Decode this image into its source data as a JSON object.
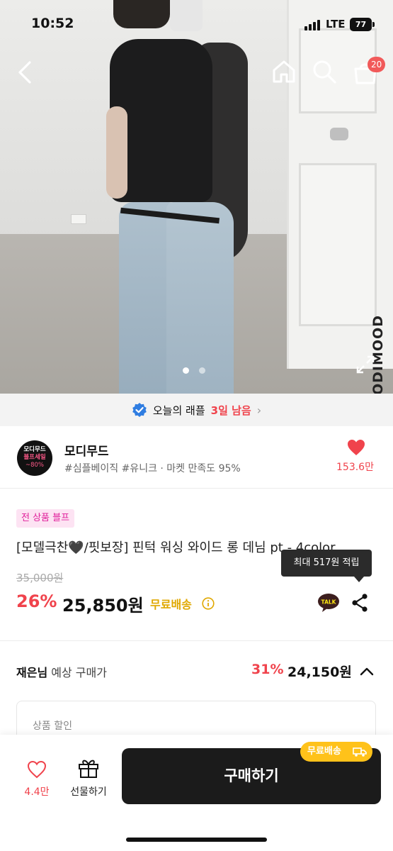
{
  "status_bar": {
    "time": "10:52",
    "network": "LTE",
    "battery": "77"
  },
  "nav": {
    "cart_count": "20"
  },
  "hero": {
    "watermark": "ODIMOOD",
    "dots": 2,
    "active_dot": 1
  },
  "raffle": {
    "label": "오늘의 래플",
    "remaining": "3일 남음"
  },
  "shop": {
    "logo_line1": "모디무드",
    "logo_line2": "블프세일",
    "logo_line3": "~80%",
    "name": "모디무드",
    "tags": "#심플베이직 #유니크 · 마켓 만족도 95%",
    "likes": "153.6만"
  },
  "product": {
    "badge": "전 상품 블프",
    "title": "[모델극찬🖤/핏보장] 핀턱 워싱 와이드 롱 데님 pt - 4color",
    "original_price": "35,000원",
    "discount_rate": "26%",
    "price": "25,850원",
    "shipping": "무료배송",
    "tooltip": "최대 517원 적립",
    "talk_label": "TALK"
  },
  "expected": {
    "user": "재은님",
    "label": " 예상 구매가",
    "rate": "31%",
    "price": "24,150원"
  },
  "discount_box": {
    "label": "상품 할인"
  },
  "bottom": {
    "fav_count": "4.4만",
    "gift_label": "선물하기",
    "buy_label": "구매하기",
    "free_chip": "무료배송"
  },
  "colors": {
    "accent_red": "#f0434c",
    "shipping_yellow": "#ffc21a",
    "badge_pink": "#e0209b",
    "buy_button": "#1b1b1b"
  }
}
